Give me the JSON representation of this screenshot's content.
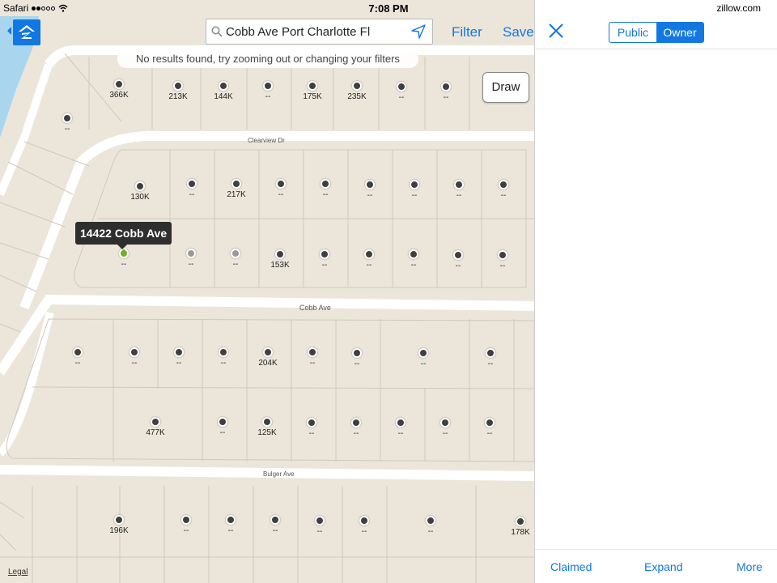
{
  "status": {
    "carrier": "Safari",
    "time": "7:08 PM",
    "site": "zillow.com"
  },
  "search": {
    "value": "Cobb Ave Port Charlotte Fl",
    "placeholder": ""
  },
  "topbar": {
    "filter": "Filter",
    "save": "Save"
  },
  "map": {
    "notice": "No results found, try zooming out or changing your filters",
    "draw": "Draw",
    "legal": "Legal",
    "callout": "14422 Cobb Ave",
    "streets": [
      "Clearview Dr",
      "Cobb Ave",
      "Bulger Ave"
    ],
    "pins": [
      "366K",
      "213K",
      "144K",
      "--",
      "175K",
      "235K",
      "--",
      "--",
      "--",
      "--",
      "130K",
      "--",
      "217K",
      "--",
      "--",
      "--",
      "--",
      "--",
      "--",
      "--",
      "--",
      "--",
      "153K",
      "--",
      "--",
      "--",
      "--",
      "--",
      "--",
      "--",
      "--",
      "--",
      "204K",
      "--",
      "--",
      "--",
      "--",
      "477K",
      "--",
      "125K",
      "--",
      "--",
      "--",
      "--",
      "--",
      "196K",
      "--",
      "--",
      "--",
      "--",
      "--",
      "--",
      "178K"
    ]
  },
  "panel": {
    "toggle": {
      "public": "Public",
      "owner": "Owner"
    },
    "footer": {
      "claimed": "Claimed",
      "expand": "Expand",
      "more": "More"
    }
  },
  "colors": {
    "accent": "#1277e1",
    "water": "#a9d6ee",
    "pin": "#3f3f3f"
  }
}
